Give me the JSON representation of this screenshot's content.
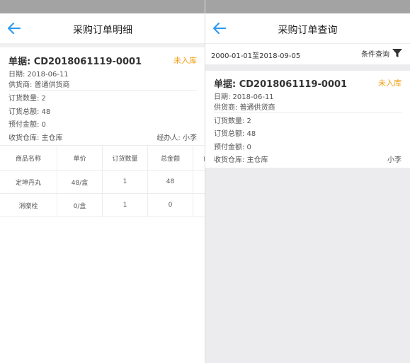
{
  "detail": {
    "title": "采购订单明细",
    "order_no": "单据: CD2018061119-0001",
    "status": "未入库",
    "date": "日期: 2018-06-11",
    "supplier": "供货商: 普通供货商",
    "quantity": "订货数量: 2",
    "total": "订货总额: 48",
    "prepaid": "预付金额: 0",
    "warehouse": "收货仓库: 主仓库",
    "handler": "经办人: 小李",
    "table": {
      "headers": [
        "商品名称",
        "单价",
        "订货数量",
        "总金额",
        "商"
      ],
      "rows": [
        [
          "定坤丹丸",
          "48/盒",
          "1",
          "48",
          ""
        ],
        [
          "消糜栓",
          "0/盒",
          "1",
          "0",
          ""
        ]
      ]
    }
  },
  "query": {
    "title": "采购订单查询",
    "date_range": "2000-01-01至2018-09-05",
    "filter_label": "条件查询",
    "card": {
      "order_no": "单据: CD2018061119-0001",
      "status": "未入库",
      "date": "日期: 2018-06-11",
      "supplier": "供货商: 普通供货商",
      "quantity": "订货数量: 2",
      "total": "订货总额: 48",
      "prepaid": "预付金额: 0",
      "warehouse": "收货仓库: 主仓库",
      "handler": "小李"
    }
  },
  "colors": {
    "accent": "#2f9bf3",
    "status": "#f39c12",
    "statusbar": "#a3a3a3"
  },
  "icons": {
    "back": "arrow-left-icon",
    "filter": "funnel-icon"
  }
}
